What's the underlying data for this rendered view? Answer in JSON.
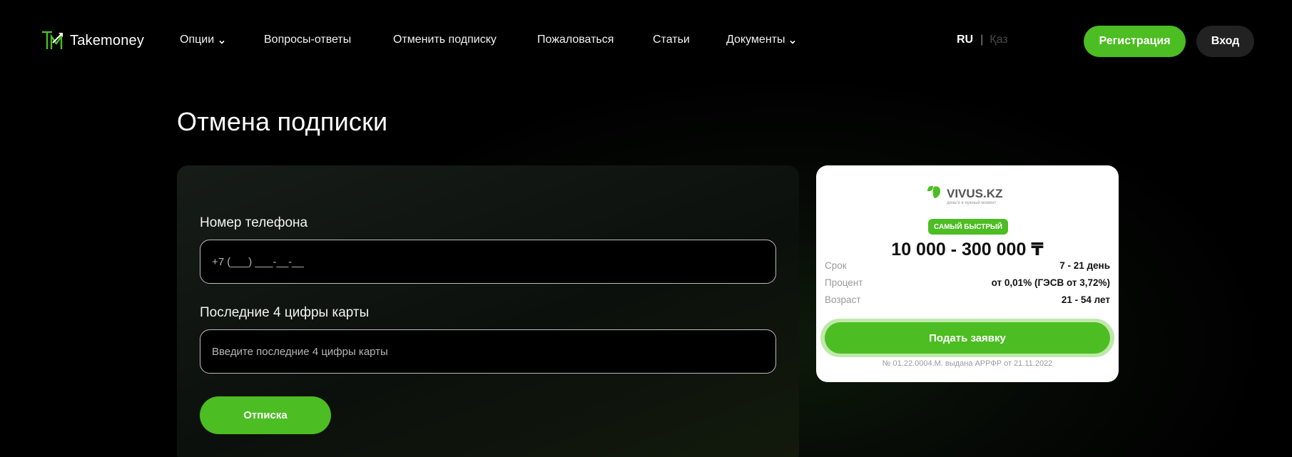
{
  "header": {
    "logo_text": "Takemoney",
    "nav": [
      {
        "label": "Опции",
        "has_dropdown": true
      },
      {
        "label": "Вопросы-ответы",
        "has_dropdown": false
      },
      {
        "label": "Отменить подписку",
        "has_dropdown": false
      },
      {
        "label": "Пожаловаться",
        "has_dropdown": false
      },
      {
        "label": "Статьи",
        "has_dropdown": false
      },
      {
        "label": "Документы",
        "has_dropdown": true
      }
    ],
    "lang": {
      "active": "RU",
      "separator": "|",
      "other": "Қаз"
    },
    "register_label": "Регистрация",
    "login_label": "Вход"
  },
  "main": {
    "title": "Отмена подписки",
    "form": {
      "phone_label": "Номер телефона",
      "phone_placeholder": "+7 (___) ___-__-__",
      "card_label": "Последние 4 цифры карты",
      "card_placeholder": "Введите последние 4 цифры карты",
      "submit_label": "Отписка"
    }
  },
  "offer": {
    "brand": "VIVUS.KZ",
    "brand_tagline": "деньги в нужный момент",
    "badge": "САМЫЙ БЫСТРЫЙ",
    "amount": "10 000 - 300 000 ₸",
    "rows": [
      {
        "key": "Срок",
        "value": "7 - 21 день"
      },
      {
        "key": "Процент",
        "value": "от 0,01% (ГЭСВ от 3,72%)"
      },
      {
        "key": "Возраст",
        "value": "21 - 54 лет"
      }
    ],
    "apply_label": "Подать заявку",
    "license": "№ 01.22.0004.М. выдана АРРФР от 21.11.2022"
  },
  "colors": {
    "accent_green": "#4cbd22",
    "background": "#000000",
    "login_button": "#222222"
  }
}
